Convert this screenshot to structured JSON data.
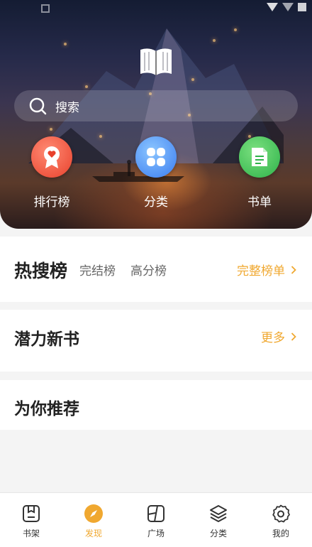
{
  "hero": {
    "search": {
      "placeholder": "搜索",
      "icon": "search-icon"
    },
    "shortcuts": [
      {
        "label": "排行榜",
        "icon": "ranking-badge-icon",
        "color": "#e8412c"
      },
      {
        "label": "分类",
        "icon": "category-grid-icon",
        "color": "#3a7cf0"
      },
      {
        "label": "书单",
        "icon": "book-list-icon",
        "color": "#2eb24a"
      }
    ]
  },
  "sections": {
    "hot": {
      "title": "热搜榜",
      "tabs": [
        "完结榜",
        "高分榜"
      ],
      "more": "完整榜单"
    },
    "potential": {
      "title": "潜力新书",
      "more": "更多"
    },
    "recommend": {
      "title": "为你推荐"
    }
  },
  "bottom_nav": {
    "items": [
      {
        "label": "书架",
        "icon": "bookshelf-icon",
        "active": false
      },
      {
        "label": "发现",
        "icon": "compass-icon",
        "active": true
      },
      {
        "label": "广场",
        "icon": "square-icon",
        "active": false
      },
      {
        "label": "分类",
        "icon": "layers-icon",
        "active": false
      },
      {
        "label": "我的",
        "icon": "gear-icon",
        "active": false
      }
    ]
  },
  "colors": {
    "accent": "#f0a830",
    "background": "#f4f4f4"
  }
}
